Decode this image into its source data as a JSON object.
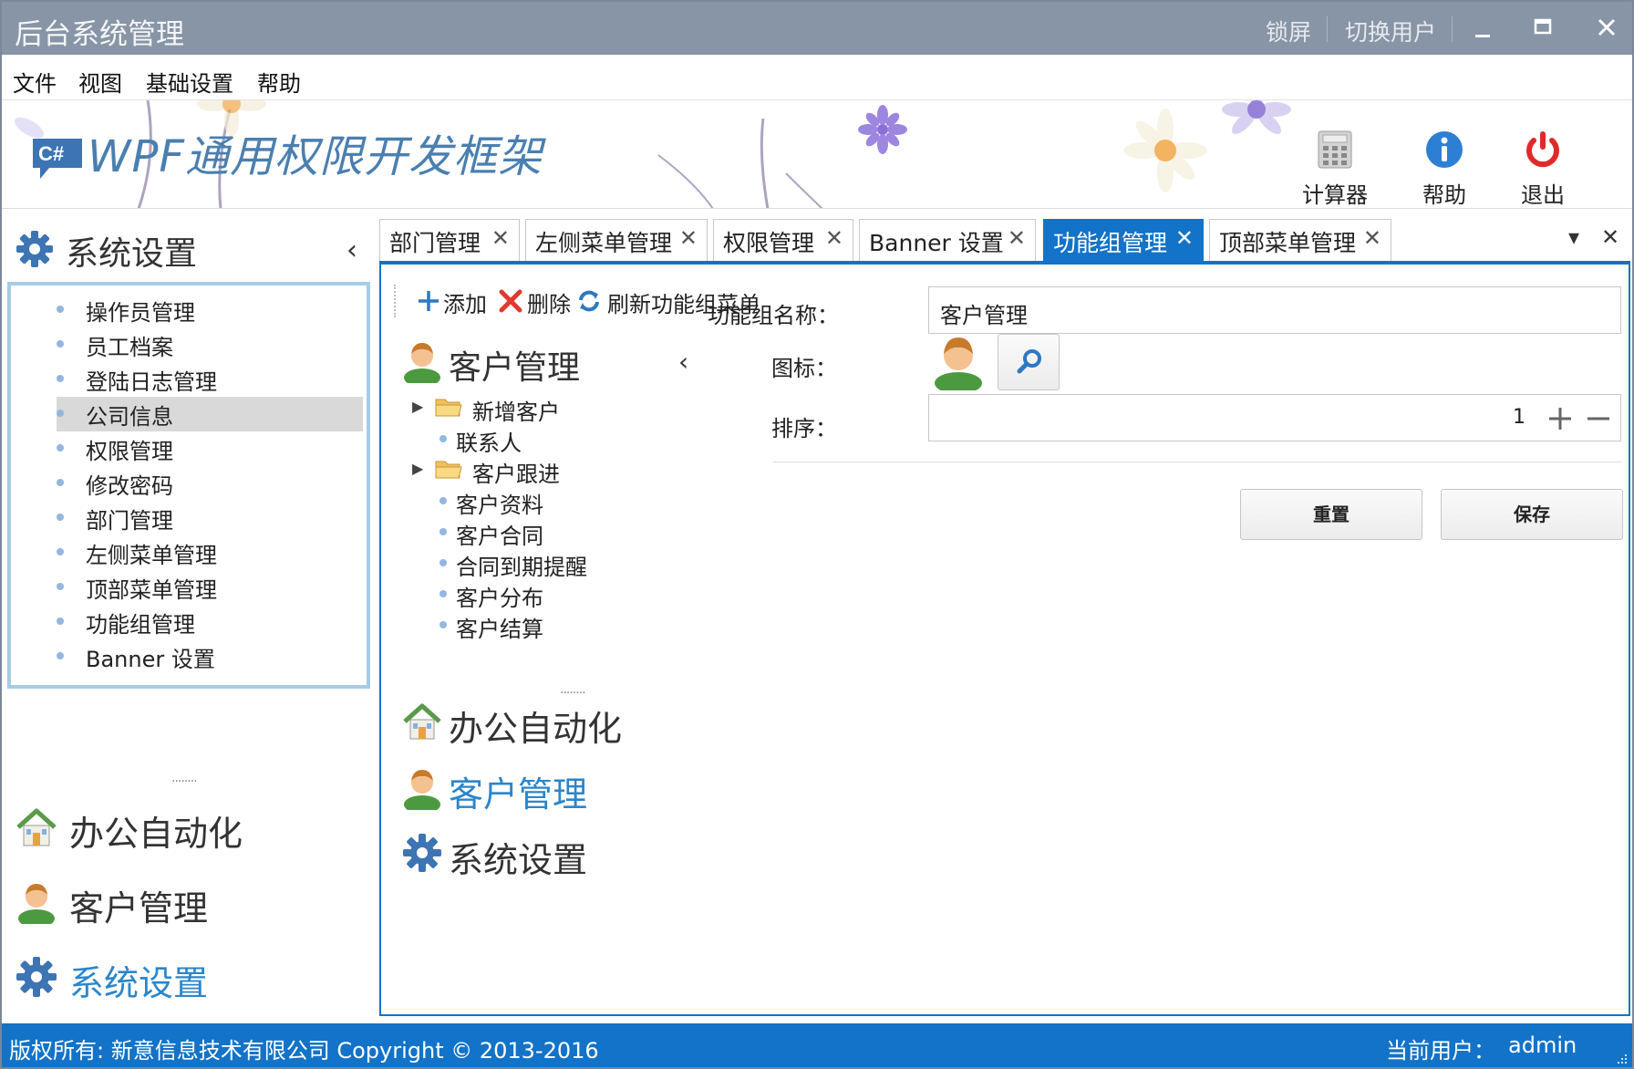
{
  "window": {
    "title": "后台系统管理",
    "lock_label": "锁屏",
    "switch_user_label": "切换用户",
    "minimize": "▁",
    "maximize": "□",
    "close": "✕"
  },
  "menu": [
    "文件",
    "视图",
    "基础设置",
    "帮助"
  ],
  "banner": {
    "logo_text": "C#",
    "app_title": "WPF通用权限开发框架",
    "buttons": [
      {
        "label": "计算器",
        "icon": "calculator-icon"
      },
      {
        "label": "帮助",
        "icon": "info-icon"
      },
      {
        "label": "退出",
        "icon": "power-icon"
      }
    ]
  },
  "sidebar": {
    "header": "系统设置",
    "items": [
      "操作员管理",
      "员工档案",
      "登陆日志管理",
      "公司信息",
      "权限管理",
      "修改密码",
      "部门管理",
      "左侧菜单管理",
      "顶部菜单管理",
      "功能组管理",
      "Banner 设置"
    ],
    "selected_index": 3,
    "grip": "........",
    "nav": [
      {
        "label": "办公自动化",
        "icon": "home-icon"
      },
      {
        "label": "客户管理",
        "icon": "user-icon"
      },
      {
        "label": "系统设置",
        "icon": "gear-icon",
        "active": true
      }
    ]
  },
  "tabs": [
    {
      "label": "部门管理"
    },
    {
      "label": "左侧菜单管理"
    },
    {
      "label": "权限管理"
    },
    {
      "label": "Banner 设置"
    },
    {
      "label": "功能组管理",
      "active": true
    },
    {
      "label": "顶部菜单管理"
    }
  ],
  "tab_close": "✕",
  "tab_tools": {
    "dropdown": "▾",
    "close": "✕"
  },
  "toolbar": {
    "add_label": "添加",
    "delete_label": "删除",
    "refresh_label": "刷新功能组菜单"
  },
  "tree": {
    "header": "客户管理",
    "rows": [
      {
        "label": "新增客户",
        "type": "folder"
      },
      {
        "label": "联系人",
        "type": "leaf"
      },
      {
        "label": "客户跟进",
        "type": "folder"
      },
      {
        "label": "客户资料",
        "type": "leaf"
      },
      {
        "label": "客户合同",
        "type": "leaf"
      },
      {
        "label": "合同到期提醒",
        "type": "leaf"
      },
      {
        "label": "客户分布",
        "type": "leaf"
      },
      {
        "label": "客户结算",
        "type": "leaf"
      }
    ],
    "grip": "........",
    "nav": [
      {
        "label": "办公自动化",
        "icon": "home-icon"
      },
      {
        "label": "客户管理",
        "icon": "user-icon",
        "active": true
      },
      {
        "label": "系统设置",
        "icon": "gear-icon"
      }
    ]
  },
  "form": {
    "name_label": "功能组名称：",
    "name_value": "客户管理",
    "icon_label": "图标：",
    "sort_label": "排序：",
    "sort_value": "1",
    "reset_label": "重置",
    "save_label": "保存"
  },
  "status": {
    "copyright": "版权所有: 新意信息技术有限公司  Copyright © 2013-2016",
    "user_label": "当前用户：",
    "user_value": "admin"
  },
  "colors": {
    "accent": "#1273c8",
    "titlebar": "#8795a6",
    "active_nav": "#2a86cc"
  }
}
